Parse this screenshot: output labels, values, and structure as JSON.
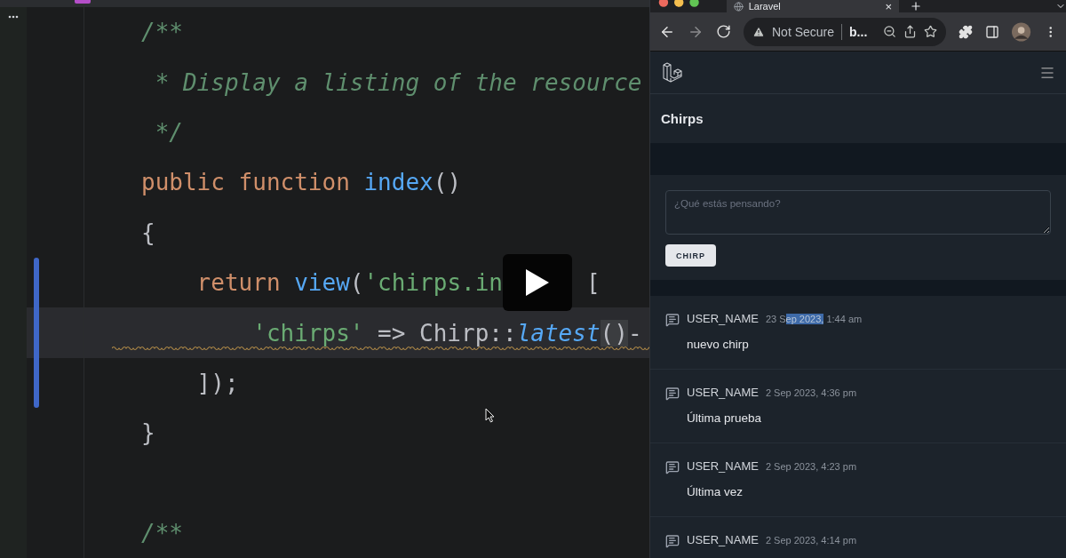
{
  "editor": {
    "lines": [
      {
        "current": false,
        "changed": false,
        "warning": false,
        "tokens": [
          {
            "kind": "comment",
            "text": "/**"
          }
        ]
      },
      {
        "current": false,
        "changed": false,
        "warning": false,
        "tokens": [
          {
            "kind": "comment",
            "text": " * Display a listing of the resource"
          }
        ]
      },
      {
        "current": false,
        "changed": false,
        "warning": false,
        "tokens": [
          {
            "kind": "comment",
            "text": " */"
          }
        ]
      },
      {
        "current": false,
        "changed": false,
        "warning": false,
        "tokens": [
          {
            "kind": "keyword",
            "text": "public function "
          },
          {
            "kind": "func",
            "text": "index"
          },
          {
            "kind": "plain",
            "text": "()"
          }
        ]
      },
      {
        "current": false,
        "changed": false,
        "warning": false,
        "tokens": [
          {
            "kind": "plain",
            "text": "{"
          }
        ]
      },
      {
        "current": false,
        "changed": true,
        "warning": false,
        "tokens": [
          {
            "kind": "keyword",
            "text": "    return "
          },
          {
            "kind": "func",
            "text": "view"
          },
          {
            "kind": "plain",
            "text": "("
          },
          {
            "kind": "string",
            "text": "'chirps.in"
          },
          {
            "kind": "covered"
          },
          {
            "kind": "plain",
            "text": " ["
          }
        ]
      },
      {
        "current": true,
        "changed": true,
        "warning": true,
        "tokens": [
          {
            "kind": "string",
            "text": "        'chirps'"
          },
          {
            "kind": "plain",
            "text": " => Chirp::"
          },
          {
            "kind": "method",
            "text": "latest"
          },
          {
            "kind": "match",
            "text": "()"
          },
          {
            "kind": "plain",
            "text": "-"
          }
        ]
      },
      {
        "current": false,
        "changed": true,
        "warning": false,
        "tokens": [
          {
            "kind": "plain",
            "text": "    ]);"
          }
        ]
      },
      {
        "current": false,
        "changed": false,
        "warning": false,
        "tokens": [
          {
            "kind": "plain",
            "text": "}"
          }
        ]
      },
      {
        "current": false,
        "changed": false,
        "warning": false
      },
      {
        "current": false,
        "changed": false,
        "warning": false,
        "tokens": [
          {
            "kind": "comment",
            "text": "/**"
          }
        ]
      }
    ]
  },
  "browser": {
    "tab": {
      "title": "Laravel",
      "close": "×"
    },
    "address": {
      "security": "Not Secure",
      "url": "b..."
    },
    "page": {
      "heading": "Chirps",
      "form": {
        "placeholder": "¿Qué estás pensando?",
        "button": "CHIRP"
      },
      "chirps": [
        {
          "user": "USER_NAME",
          "date_parts": [
            {
              "text": "23 S",
              "selected": false
            },
            {
              "text": "ep 2023,",
              "selected": true
            },
            {
              "text": " 1:44 am",
              "selected": false
            }
          ],
          "message": "nuevo chirp"
        },
        {
          "user": "USER_NAME",
          "date_parts": [
            {
              "text": "2 Sep 2023, 4:36 pm",
              "selected": false
            }
          ],
          "message": "Última prueba"
        },
        {
          "user": "USER_NAME",
          "date_parts": [
            {
              "text": "2 Sep 2023, 4:23 pm",
              "selected": false
            }
          ],
          "message": "Última vez"
        },
        {
          "user": "USER_NAME",
          "date_parts": [
            {
              "text": "2 Sep 2023, 4:14 pm",
              "selected": false
            }
          ]
        }
      ]
    }
  }
}
